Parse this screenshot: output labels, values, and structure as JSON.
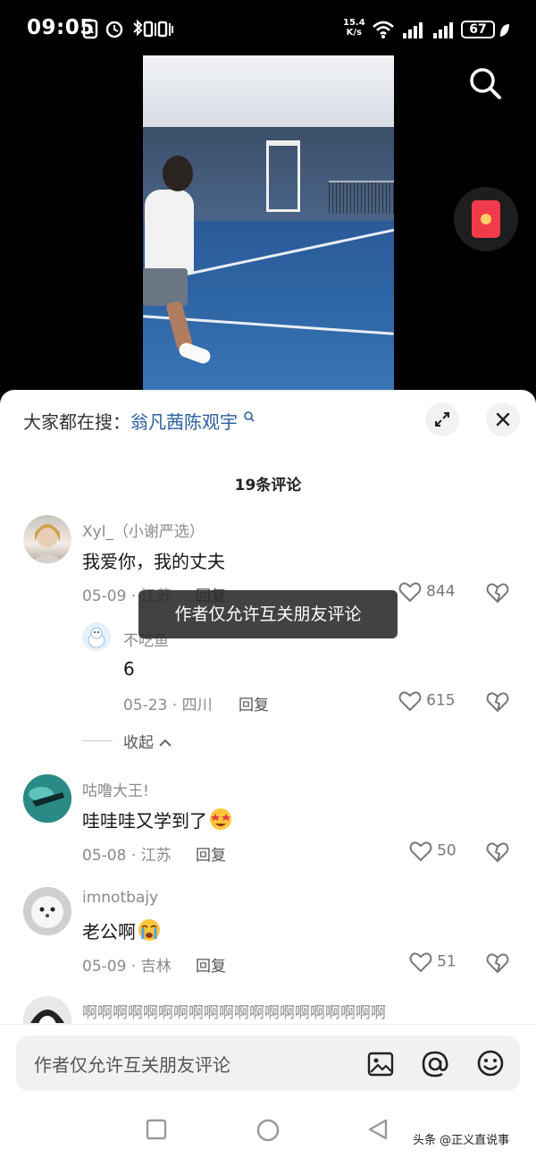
{
  "status_bar": {
    "time": "09:05",
    "net_speed_value": "15.4",
    "net_speed_unit": "K/s",
    "battery": "67"
  },
  "video": {
    "icons": [
      "search-icon",
      "red-packet-icon"
    ]
  },
  "panel": {
    "search_prefix": "大家都在搜：",
    "search_keyword": "翁凡茜陈观宇",
    "comment_count": "19条评论",
    "toast": "作者仅允许互关朋友评论",
    "comments": [
      {
        "user": "Xyl_（小谢严选）",
        "text": "我爱你，我的丈夫",
        "date": "05-09",
        "location": "江苏",
        "reply": "回复",
        "likes": "844"
      },
      {
        "user": "不吃鱼",
        "text": "6",
        "date": "05-23",
        "location": "四川",
        "reply": "回复",
        "likes": "615"
      },
      {
        "user": "咕噜大王!",
        "text": "哇哇哇又学到了",
        "date": "05-08",
        "location": "江苏",
        "reply": "回复",
        "likes": "50"
      },
      {
        "user": "imnotbajy",
        "text": "老公啊",
        "date": "05-09",
        "location": "吉林",
        "reply": "回复",
        "likes": "51"
      },
      {
        "user": "啊啊啊啊啊啊啊啊啊啊啊啊啊啊啊啊啊啊啊啊"
      }
    ],
    "collapse_label": "收起",
    "input_placeholder": "作者仅允许互关朋友评论"
  },
  "watermark": "头条 @正义直说事",
  "colors": {
    "keyword": "#2b5e9e",
    "red_packet": "#f23b4a"
  }
}
